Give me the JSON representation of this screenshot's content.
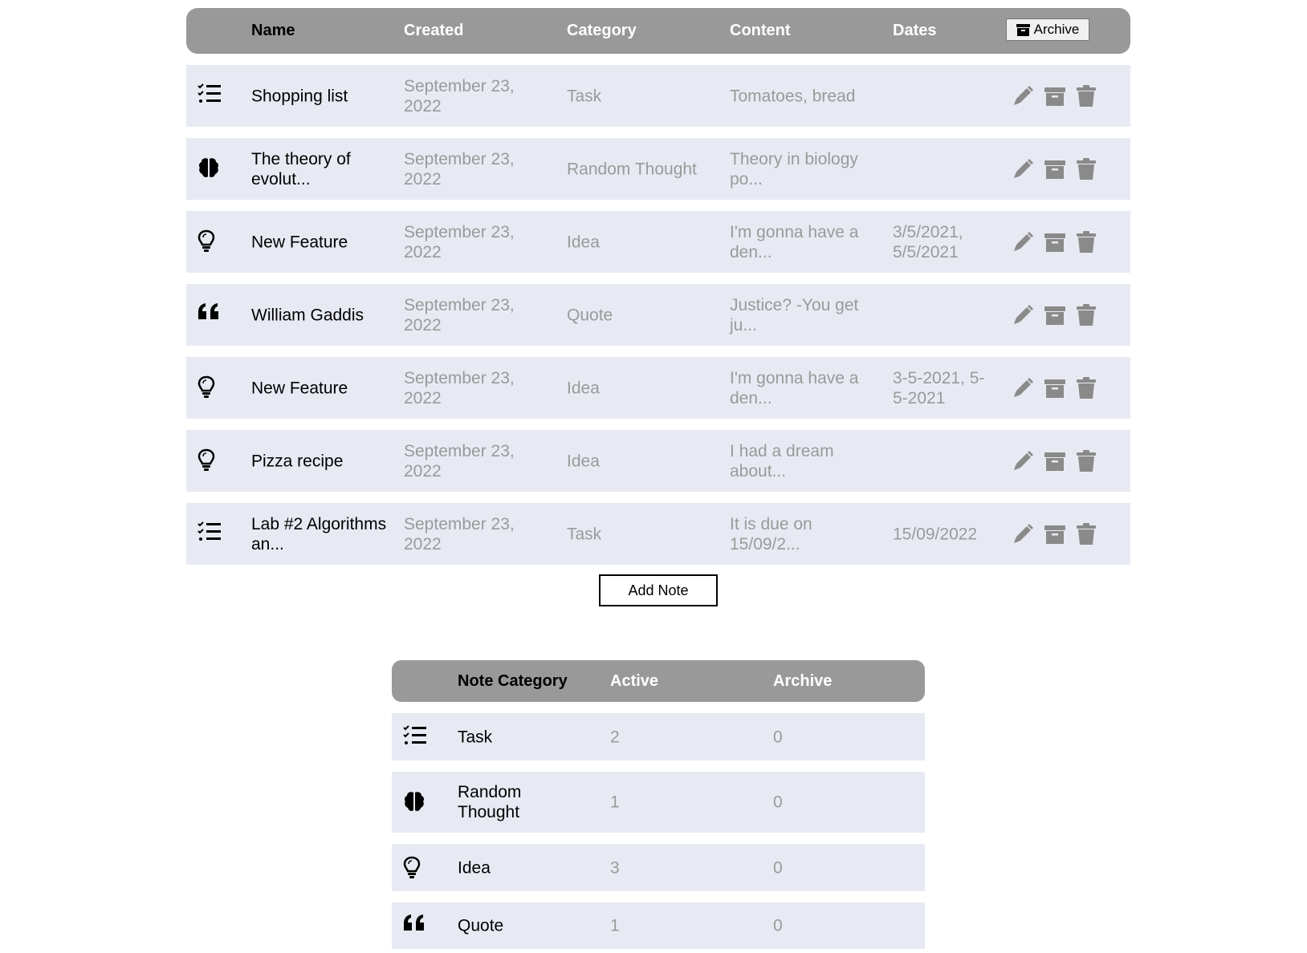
{
  "notes_table": {
    "headers": {
      "name": "Name",
      "created": "Created",
      "category": "Category",
      "content": "Content",
      "dates": "Dates",
      "archive_button": "Archive"
    },
    "rows": [
      {
        "icon": "task-list-icon",
        "name": "Shopping list",
        "created": "September 23, 2022",
        "category": "Task",
        "content": "Tomatoes, bread",
        "dates": ""
      },
      {
        "icon": "brain-icon",
        "name": "The theory of evolut...",
        "created": "September 23, 2022",
        "category": "Random Thought",
        "content": "Theory in biology po...",
        "dates": ""
      },
      {
        "icon": "lightbulb-icon",
        "name": "New Feature",
        "created": "September 23, 2022",
        "category": "Idea",
        "content": "I'm gonna have a den...",
        "dates": "3/5/2021, 5/5/2021"
      },
      {
        "icon": "quote-icon",
        "name": "William Gaddis",
        "created": "September 23, 2022",
        "category": "Quote",
        "content": "Justice? -You get ju...",
        "dates": ""
      },
      {
        "icon": "lightbulb-icon",
        "name": "New Feature",
        "created": "September 23, 2022",
        "category": "Idea",
        "content": "I'm gonna have a den...",
        "dates": "3-5-2021, 5-5-2021"
      },
      {
        "icon": "lightbulb-icon",
        "name": "Pizza recipe",
        "created": "September 23, 2022",
        "category": "Idea",
        "content": "I had a dream about...",
        "dates": ""
      },
      {
        "icon": "task-list-icon",
        "name": "Lab #2 Algorithms an...",
        "created": "September 23, 2022",
        "category": "Task",
        "content": "It is due on 15/09/2...",
        "dates": "15/09/2022"
      }
    ]
  },
  "add_note_button": "Add Note",
  "summary_table": {
    "headers": {
      "category": "Note Category",
      "active": "Active",
      "archive": "Archive"
    },
    "rows": [
      {
        "icon": "task-list-icon",
        "category": "Task",
        "active": "2",
        "archive": "0"
      },
      {
        "icon": "brain-icon",
        "category": "Random Thought",
        "active": "1",
        "archive": "0"
      },
      {
        "icon": "lightbulb-icon",
        "category": "Idea",
        "active": "3",
        "archive": "0"
      },
      {
        "icon": "quote-icon",
        "category": "Quote",
        "active": "1",
        "archive": "0"
      }
    ]
  },
  "colors": {
    "header_bg": "#999999",
    "row_bg": "#e8eaf3",
    "muted_text": "#9a9a9a",
    "action_icon": "#8a8a8a"
  }
}
